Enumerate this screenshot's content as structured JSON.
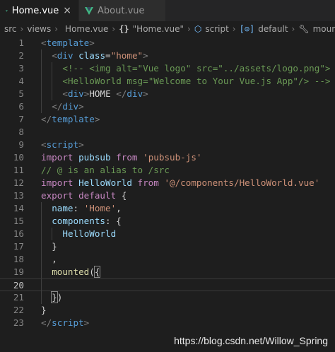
{
  "tabs": [
    {
      "label": "Home.vue",
      "active": true,
      "close": "×"
    },
    {
      "label": "About.vue",
      "active": false
    }
  ],
  "breadcrumb": {
    "src": "src",
    "views": "views",
    "file": "Home.vue",
    "template_icon": "{}",
    "template": "\"Home.vue\"",
    "script": "script",
    "default_icon": "[⊙]",
    "default": "default",
    "mounted": "mount"
  },
  "colors": {
    "tag": "#569cd6",
    "attr": "#9cdcfe",
    "string": "#ce9178",
    "keyword": "#c586c0",
    "comment": "#6a9955",
    "text": "#d4d4d4",
    "method": "#dcdcaa",
    "vue_green": "#41b883"
  },
  "lines": [
    {
      "n": 1,
      "tokens": [
        [
          "<",
          "#808080"
        ],
        [
          "template",
          "#569cd6"
        ],
        [
          ">",
          "#808080"
        ]
      ]
    },
    {
      "n": 2,
      "indent": 1,
      "tokens": [
        [
          "<",
          "#808080"
        ],
        [
          "div",
          "#569cd6"
        ],
        [
          " ",
          ""
        ],
        [
          "class",
          "#9cdcfe"
        ],
        [
          "=",
          "#d4d4d4"
        ],
        [
          "\"home\"",
          "#ce9178"
        ],
        [
          ">",
          "#808080"
        ]
      ]
    },
    {
      "n": 3,
      "indent": 2,
      "tokens": [
        [
          "<!-- <img alt=\"Vue logo\" src=\"../assets/logo.png\">",
          "#6a9955"
        ]
      ]
    },
    {
      "n": 4,
      "indent": 2,
      "tokens": [
        [
          "<HelloWorld msg=\"Welcome to Your Vue.js App\"/> -->",
          "#6a9955"
        ]
      ]
    },
    {
      "n": 5,
      "indent": 2,
      "tokens": [
        [
          "<",
          "#808080"
        ],
        [
          "div",
          "#569cd6"
        ],
        [
          ">",
          "#808080"
        ],
        [
          "HOME ",
          "#d4d4d4"
        ],
        [
          "</",
          "#808080"
        ],
        [
          "div",
          "#569cd6"
        ],
        [
          ">",
          "#808080"
        ]
      ]
    },
    {
      "n": 6,
      "indent": 1,
      "tokens": [
        [
          "</",
          "#808080"
        ],
        [
          "div",
          "#569cd6"
        ],
        [
          ">",
          "#808080"
        ]
      ]
    },
    {
      "n": 7,
      "tokens": [
        [
          "</",
          "#808080"
        ],
        [
          "template",
          "#569cd6"
        ],
        [
          ">",
          "#808080"
        ]
      ]
    },
    {
      "n": 8,
      "tokens": []
    },
    {
      "n": 9,
      "tokens": [
        [
          "<",
          "#808080"
        ],
        [
          "script",
          "#569cd6"
        ],
        [
          ">",
          "#808080"
        ]
      ]
    },
    {
      "n": 10,
      "tokens": [
        [
          "import",
          "#c586c0"
        ],
        [
          " pubsub ",
          "#9cdcfe"
        ],
        [
          "from",
          "#c586c0"
        ],
        [
          " ",
          ""
        ],
        [
          "'pubsub-js'",
          "#ce9178"
        ]
      ]
    },
    {
      "n": 11,
      "tokens": [
        [
          "// @ is an alias to /src",
          "#6a9955"
        ]
      ]
    },
    {
      "n": 12,
      "tokens": [
        [
          "import",
          "#c586c0"
        ],
        [
          " HelloWorld ",
          "#9cdcfe"
        ],
        [
          "from",
          "#c586c0"
        ],
        [
          " ",
          ""
        ],
        [
          "'@/components/HelloWorld.vue'",
          "#ce9178"
        ]
      ]
    },
    {
      "n": 13,
      "tokens": [
        [
          "export",
          "#c586c0"
        ],
        [
          " ",
          ""
        ],
        [
          "default",
          "#c586c0"
        ],
        [
          " {",
          "#d4d4d4"
        ]
      ]
    },
    {
      "n": 14,
      "indent": 1,
      "tokens": [
        [
          "name",
          "#9cdcfe"
        ],
        [
          ": ",
          "#d4d4d4"
        ],
        [
          "'Home'",
          "#ce9178"
        ],
        [
          ",",
          "#d4d4d4"
        ]
      ]
    },
    {
      "n": 15,
      "indent": 1,
      "tokens": [
        [
          "components",
          "#9cdcfe"
        ],
        [
          ": {",
          "#d4d4d4"
        ]
      ]
    },
    {
      "n": 16,
      "indent": 2,
      "tokens": [
        [
          "HelloWorld",
          "#9cdcfe"
        ]
      ]
    },
    {
      "n": 17,
      "indent": 1,
      "tokens": [
        [
          "}",
          "#d4d4d4"
        ]
      ]
    },
    {
      "n": 18,
      "indent": 1,
      "tokens": [
        [
          ",",
          "#d4d4d4"
        ]
      ]
    },
    {
      "n": 19,
      "indent": 1,
      "tokens": [
        [
          "mounted",
          "#dcdcaa"
        ],
        [
          "(",
          "#d4d4d4"
        ],
        [
          "{",
          "#d4d4d4",
          "match"
        ]
      ]
    },
    {
      "n": 20,
      "indent": 1,
      "current": true,
      "tokens": []
    },
    {
      "n": 21,
      "indent": 1,
      "tokens": [
        [
          "}",
          "#d4d4d4",
          "match"
        ],
        [
          ")",
          "#d4d4d4"
        ]
      ]
    },
    {
      "n": 22,
      "tokens": [
        [
          "}",
          "#d4d4d4"
        ]
      ]
    },
    {
      "n": 23,
      "tokens": [
        [
          "</",
          "#808080"
        ],
        [
          "script",
          "#569cd6"
        ],
        [
          ">",
          "#808080"
        ]
      ]
    }
  ],
  "watermark": "https://blog.csdn.net/Willow_Spring"
}
